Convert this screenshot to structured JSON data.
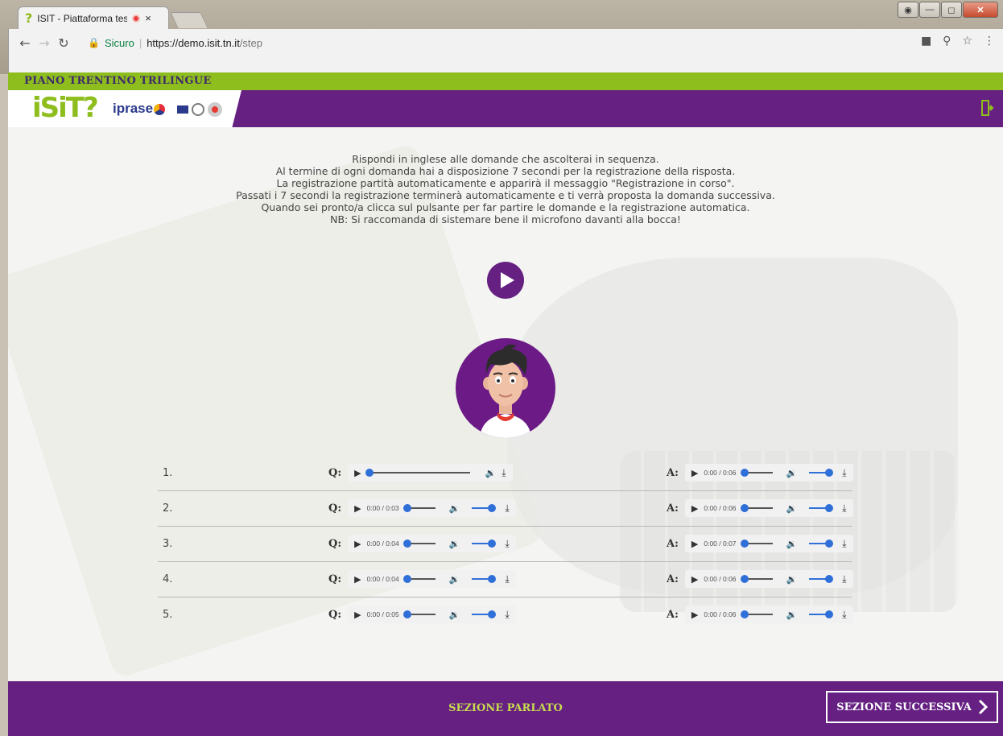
{
  "browser": {
    "tab_title": "ISIT - Piattaforma test",
    "tab_close": "×",
    "secure_label": "Sicuro",
    "url_scheme_host": "https://demo.isit.tn.it",
    "url_path": "/step"
  },
  "header": {
    "program_title": "PIANO TRENTINO TRILINGUE",
    "logo_isit": "iSiT?",
    "logo_iprase": "iprase"
  },
  "instructions": [
    "Rispondi in inglese alle domande che ascolterai in sequenza.",
    "Al termine di ogni domanda hai a disposizione 7 secondi per la registrazione della risposta.",
    "La registrazione partità automaticamente e apparirà il messaggio \"Registrazione in corso\".",
    "Passati i 7 secondi la registrazione terminerà automaticamente e ti verrà proposta la domanda successiva.",
    "Quando sei pronto/a clicca sul pulsante per far partire le domande e la registrazione automatica.",
    "NB: Si raccomanda di sistemare bene il microfono davanti alla bocca!"
  ],
  "rows": [
    {
      "num": "1.",
      "q_label": "Q:",
      "q_time": "",
      "a_label": "A:",
      "a_time": "0:00 / 0:06"
    },
    {
      "num": "2.",
      "q_label": "Q:",
      "q_time": "0:00 / 0:03",
      "a_label": "A:",
      "a_time": "0:00 / 0:06"
    },
    {
      "num": "3.",
      "q_label": "Q:",
      "q_time": "0:00 / 0:04",
      "a_label": "A:",
      "a_time": "0:00 / 0:07"
    },
    {
      "num": "4.",
      "q_label": "Q:",
      "q_time": "0:00 / 0:04",
      "a_label": "A:",
      "a_time": "0:00 / 0:06"
    },
    {
      "num": "5.",
      "q_label": "Q:",
      "q_time": "0:00 / 0:05",
      "a_label": "A:",
      "a_time": "0:00 / 0:06"
    }
  ],
  "footer": {
    "section_name": "SEZIONE PARLATO",
    "next_label": "SEZIONE SUCCESSIVA"
  },
  "colors": {
    "purple": "#652082",
    "green": "#8ebd1e",
    "player_blue": "#2f6fd8"
  },
  "icons": [
    "favicon-question-icon",
    "recording-dot-icon",
    "back-arrow-icon",
    "forward-arrow-icon",
    "reload-icon",
    "lock-icon",
    "camera-icon",
    "zoom-icon",
    "star-icon",
    "menu-icon",
    "exit-door-icon",
    "play-circle-icon",
    "play-icon",
    "volume-icon",
    "download-icon",
    "chevron-right-icon"
  ]
}
